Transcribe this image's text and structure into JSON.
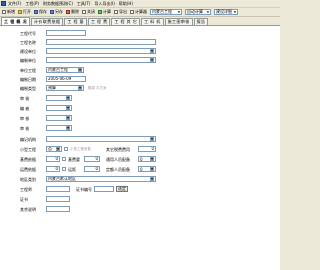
{
  "menu": {
    "items": [
      "文件(F)",
      "工程(P)",
      "财务数据预测(C)",
      "工具(T)",
      "导入导出(I)",
      "帮助(H)"
    ]
  },
  "toolbar": {
    "buttons": [
      "新增",
      "打开",
      "保存",
      "另存",
      "删除",
      "关闭",
      "计算",
      "导出",
      "计算器"
    ],
    "project_select": "内蒙古工程",
    "calc_select": "自动计算",
    "doc_select": "建设详细"
  },
  "tabs": [
    "工  程  概  况",
    "计价取费依据",
    "工  程  量",
    "工  程  费",
    "工  程  其  它",
    "工  料  机",
    "施工图审核",
    "报告"
  ],
  "form": {
    "project_code_label": "工程代号",
    "project_name_label": "工程名称",
    "build_unit_label": "建设单位",
    "design_unit_label": "编制单位",
    "province_label": "单位工程",
    "province_value": "内蒙古工程",
    "date_label": "编制日期",
    "date_value": "2005-06-09",
    "type_label": "编制类型",
    "type_value": "预算",
    "type_hint": "概算 平方米",
    "check_label": "审  核",
    "prepare_label": "编  者",
    "review_label": "审  核",
    "approve_label": "审  核",
    "seal_label": "编记机构",
    "small_project_label": "小型工程",
    "small_project_value": "否",
    "small_project_hint": "小型工程系数",
    "other_fee_label": "其它税费费用",
    "other_fee_value": "0",
    "dist_a_label": "基费依据",
    "dist_a_value": "0",
    "fee_plan_label": "基费要",
    "fee_plan_value": "0",
    "loc_label": "通用人员配备",
    "loc_value": "0",
    "dist_b_label": "运费依据",
    "dist_b_value": "0",
    "dist_b2_label": "运距",
    "dist_b2_value": "0",
    "staff_label": "定额人员配备",
    "staff_value": "0",
    "region_label": "地区类别",
    "region_value": "内蒙古默认地区",
    "engineer_label": "工程师",
    "cert_label": "证书",
    "cert_no_label": "证书编号",
    "apply_button": "选定",
    "remark_label": "其余说明"
  },
  "colors": {
    "chrome": "#ece9d8",
    "input_border": "#7f9db9",
    "tab_border": "#919b9c"
  }
}
